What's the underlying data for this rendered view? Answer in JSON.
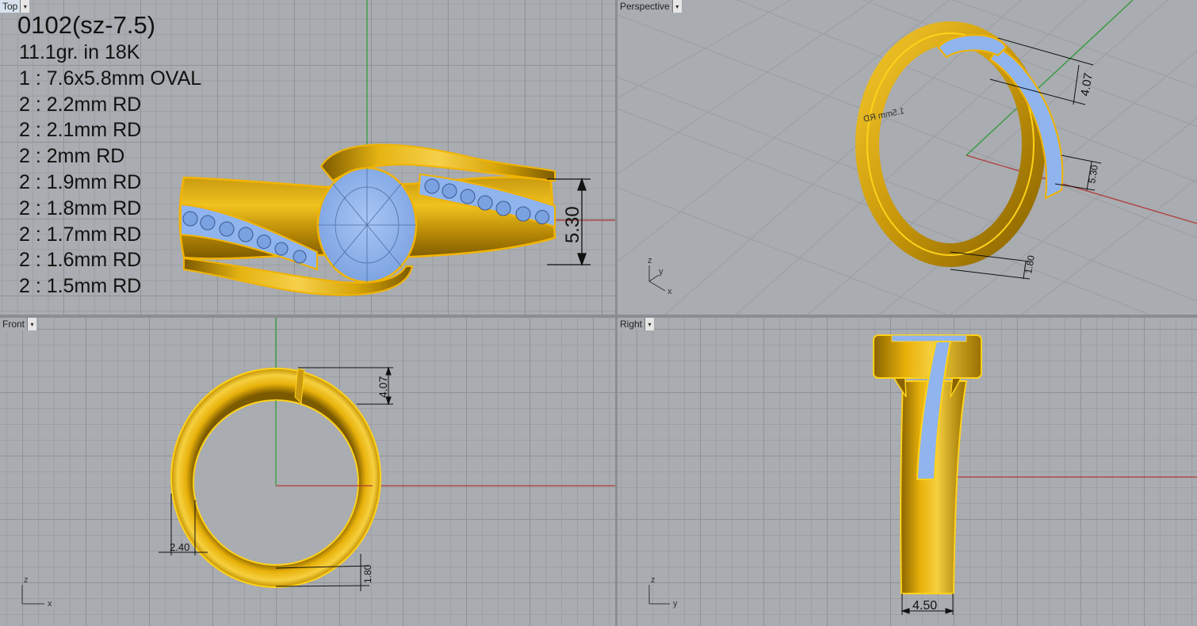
{
  "viewports": {
    "top": {
      "label": "Top"
    },
    "perspective": {
      "label": "Perspective"
    },
    "front": {
      "label": "Front"
    },
    "right": {
      "label": "Right"
    }
  },
  "specs": {
    "title": "0102(sz-7.5)",
    "lines": [
      "11.1gr.  in 18K",
      "1 : 7.6x5.8mm OVAL",
      "2 : 2.2mm RD",
      "2 : 2.1mm RD",
      "2 : 2mm RD",
      "2 : 1.9mm RD",
      "2 : 1.8mm RD",
      "2 : 1.7mm RD",
      "2 : 1.6mm RD",
      "2 : 1.5mm RD"
    ]
  },
  "dimensions": {
    "top_width": "5.30",
    "persp_height": "4.07",
    "persp_width": "5.30",
    "persp_bottom": "1.80",
    "front_height": "4.07",
    "front_side": "2.40",
    "front_bottom": "1.80",
    "right_width": "4.50"
  },
  "axes": {
    "x": "x",
    "y": "y",
    "z": "z"
  },
  "colors": {
    "gold": "#e8b10a",
    "gold_dark": "#8a6200",
    "stone": "#8fb4ee",
    "grid": "#8f9297",
    "background": "#a9acb0",
    "axis_x": "#b33a3a",
    "axis_y": "#2e9a3a"
  }
}
